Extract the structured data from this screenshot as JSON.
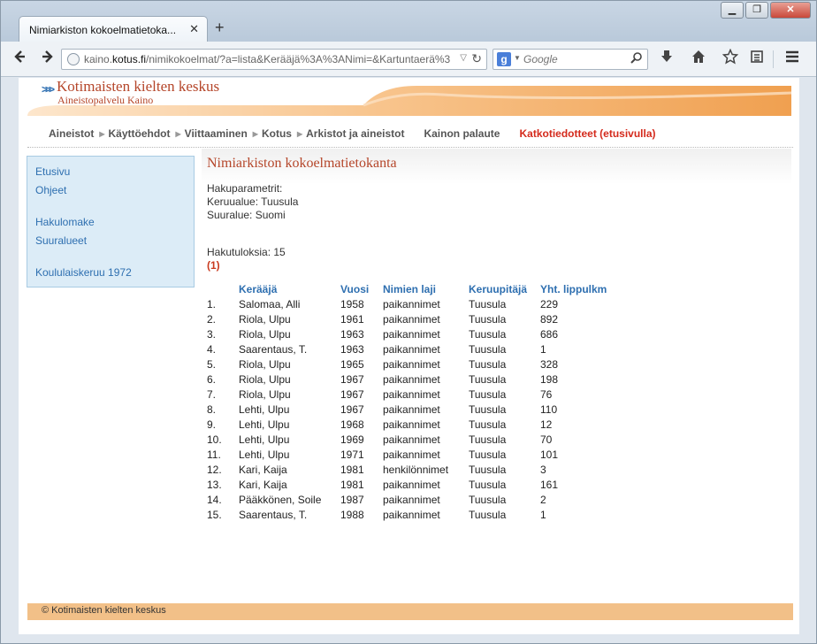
{
  "browser": {
    "tab_title": "Nimiarkiston kokoelmatietoka...",
    "tab_close": "✕",
    "new_tab": "+",
    "url_prefix": "kaino.",
    "url_domain": "kotus.fi",
    "url_rest": "/nimikokoelmat/?a=lista&Kerääjä%3A%3ANimi=&Kartuntaerä%3",
    "search_placeholder": "Google",
    "window_buttons": [
      "▁",
      "❐",
      "✕"
    ]
  },
  "header": {
    "title": "Kotimaisten kielten keskus",
    "subtitle": "Aineistopalvelu Kaino",
    "accent_color": "#f0a050"
  },
  "mainnav": [
    {
      "label": "Aineistot",
      "highlight": false
    },
    {
      "label": "Käyttöehdot",
      "highlight": false
    },
    {
      "label": "Viittaaminen",
      "highlight": false
    },
    {
      "label": "Kotus",
      "highlight": false
    },
    {
      "label": "Arkistot ja aineistot",
      "highlight": false
    },
    {
      "label": "Kainon palaute",
      "highlight": false
    },
    {
      "label": "Katkotiedotteet (etusivulla)",
      "highlight": true
    }
  ],
  "sidebar": {
    "items": [
      {
        "label": "Etusivu"
      },
      {
        "label": "Ohjeet"
      },
      {
        "label": "Hakulomake"
      },
      {
        "label": "Suuralueet"
      },
      {
        "label": "Koululaiskeruu 1972"
      }
    ]
  },
  "content": {
    "title": "Nimiarkiston kokoelmatietokanta",
    "params_label": "Hakuparametrit:",
    "param_area": "Keruualue: Tuusula",
    "param_region": "Suuralue: Suomi",
    "results_count": "Hakutuloksia: 15",
    "page_link": "(1)"
  },
  "table": {
    "headers": [
      "",
      "Kerääjä",
      "Vuosi",
      "Nimien laji",
      "Keruupitäjä",
      "Yht. lippulkm"
    ],
    "rows": [
      [
        "1.",
        "Salomaa, Alli",
        "1958",
        "paikannimet",
        "Tuusula",
        "229"
      ],
      [
        "2.",
        "Riola, Ulpu",
        "1961",
        "paikannimet",
        "Tuusula",
        "892"
      ],
      [
        "3.",
        "Riola, Ulpu",
        "1963",
        "paikannimet",
        "Tuusula",
        "686"
      ],
      [
        "4.",
        "Saarentaus, T.",
        "1963",
        "paikannimet",
        "Tuusula",
        "1"
      ],
      [
        "5.",
        "Riola, Ulpu",
        "1965",
        "paikannimet",
        "Tuusula",
        "328"
      ],
      [
        "6.",
        "Riola, Ulpu",
        "1967",
        "paikannimet",
        "Tuusula",
        "198"
      ],
      [
        "7.",
        "Riola, Ulpu",
        "1967",
        "paikannimet",
        "Tuusula",
        "76"
      ],
      [
        "8.",
        "Lehti, Ulpu",
        "1967",
        "paikannimet",
        "Tuusula",
        "110"
      ],
      [
        "9.",
        "Lehti, Ulpu",
        "1968",
        "paikannimet",
        "Tuusula",
        "12"
      ],
      [
        "10.",
        "Lehti, Ulpu",
        "1969",
        "paikannimet",
        "Tuusula",
        "70"
      ],
      [
        "11.",
        "Lehti, Ulpu",
        "1971",
        "paikannimet",
        "Tuusula",
        "101"
      ],
      [
        "12.",
        "Kari, Kaija",
        "1981",
        "henkilönnimet",
        "Tuusula",
        "3"
      ],
      [
        "13.",
        "Kari, Kaija",
        "1981",
        "paikannimet",
        "Tuusula",
        "161"
      ],
      [
        "14.",
        "Pääkkönen, Soile",
        "1987",
        "paikannimet",
        "Tuusula",
        "2"
      ],
      [
        "15.",
        "Saarentaus, T.",
        "1988",
        "paikannimet",
        "Tuusula",
        "1"
      ]
    ]
  },
  "footer": {
    "text": "© Kotimaisten kielten keskus"
  }
}
